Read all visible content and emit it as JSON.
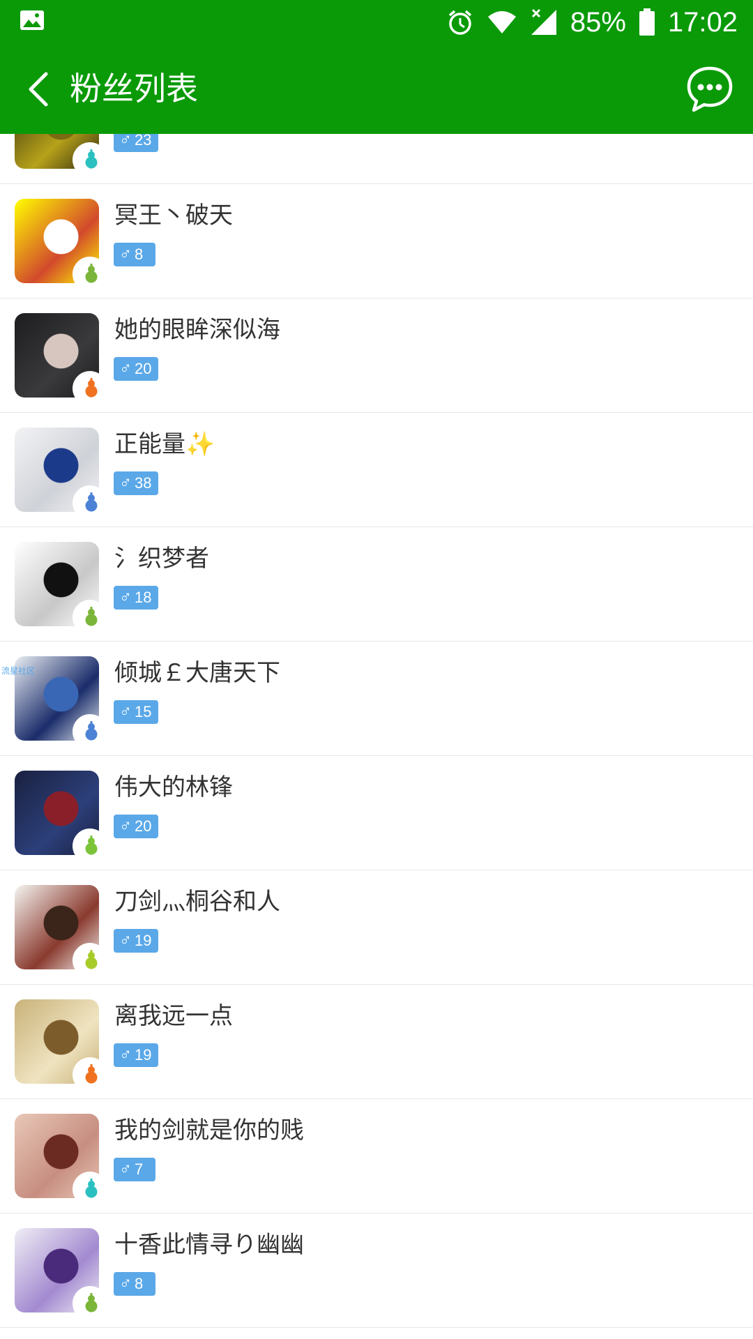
{
  "status_bar": {
    "battery": "85%",
    "time": "17:02",
    "icons": [
      "image-icon",
      "alarm-icon",
      "wifi-icon",
      "cellular-icon",
      "battery-icon"
    ]
  },
  "app_bar": {
    "title": "粉丝列表",
    "back_icon": "chevron-left-icon",
    "action_icon": "chat-bubble-icon"
  },
  "watermark": "流星社区",
  "fans": [
    {
      "name": "",
      "gender_symbol": "♂",
      "level": "23",
      "gourd_color": "#2bc0c0",
      "avatar_colors": [
        "#2f2a10",
        "#7a6a12",
        "#b7a21a"
      ]
    },
    {
      "name": "冥王丶破天",
      "gender_symbol": "♂",
      "level": "8",
      "gourd_color": "#7bb53a",
      "avatar_colors": [
        "#ffff00",
        "#ffffff",
        "#d24a2c"
      ]
    },
    {
      "name": "她的眼眸深似海",
      "gender_symbol": "♂",
      "level": "20",
      "gourd_color": "#f07220",
      "avatar_colors": [
        "#1d1d1f",
        "#d7c6c0",
        "#3a3a3c"
      ]
    },
    {
      "name": "正能量✨",
      "gender_symbol": "♂",
      "level": "38",
      "gourd_color": "#4c82d6",
      "avatar_colors": [
        "#f3f3f5",
        "#1c3a8a",
        "#cfd2d8"
      ]
    },
    {
      "name": "氵织梦者",
      "gender_symbol": "♂",
      "level": "18",
      "gourd_color": "#7bb53a",
      "avatar_colors": [
        "#ffffff",
        "#111111",
        "#c8c8c8"
      ]
    },
    {
      "name": "倾城￡大唐天下",
      "gender_symbol": "♂",
      "level": "15",
      "gourd_color": "#4c82d6",
      "avatar_colors": [
        "#e9eef3",
        "#3a67b5",
        "#1a2c6a"
      ]
    },
    {
      "name": "伟大的林锋",
      "gender_symbol": "♂",
      "level": "20",
      "gourd_color": "#7bc43a",
      "avatar_colors": [
        "#1a2140",
        "#8a1f2a",
        "#2c3f7a"
      ]
    },
    {
      "name": "刀剑灬桐谷和人",
      "gender_symbol": "♂",
      "level": "19",
      "gourd_color": "#a7cc2a",
      "avatar_colors": [
        "#f5f5f2",
        "#3b241a",
        "#8a3a2e"
      ]
    },
    {
      "name": "离我远一点",
      "gender_symbol": "♂",
      "level": "19",
      "gourd_color": "#f07220",
      "avatar_colors": [
        "#c9b27a",
        "#7c5c2a",
        "#efe3c0"
      ]
    },
    {
      "name": "我的剑就是你的贱",
      "gender_symbol": "♂",
      "level": "7",
      "gourd_color": "#2bc0c0",
      "avatar_colors": [
        "#e8c7b7",
        "#6b2a22",
        "#c78e80"
      ]
    },
    {
      "name": "十香此情寻り幽幽",
      "gender_symbol": "♂",
      "level": "8",
      "gourd_color": "#7bb53a",
      "avatar_colors": [
        "#f0eef5",
        "#4a2a7a",
        "#a38ad0"
      ]
    }
  ]
}
